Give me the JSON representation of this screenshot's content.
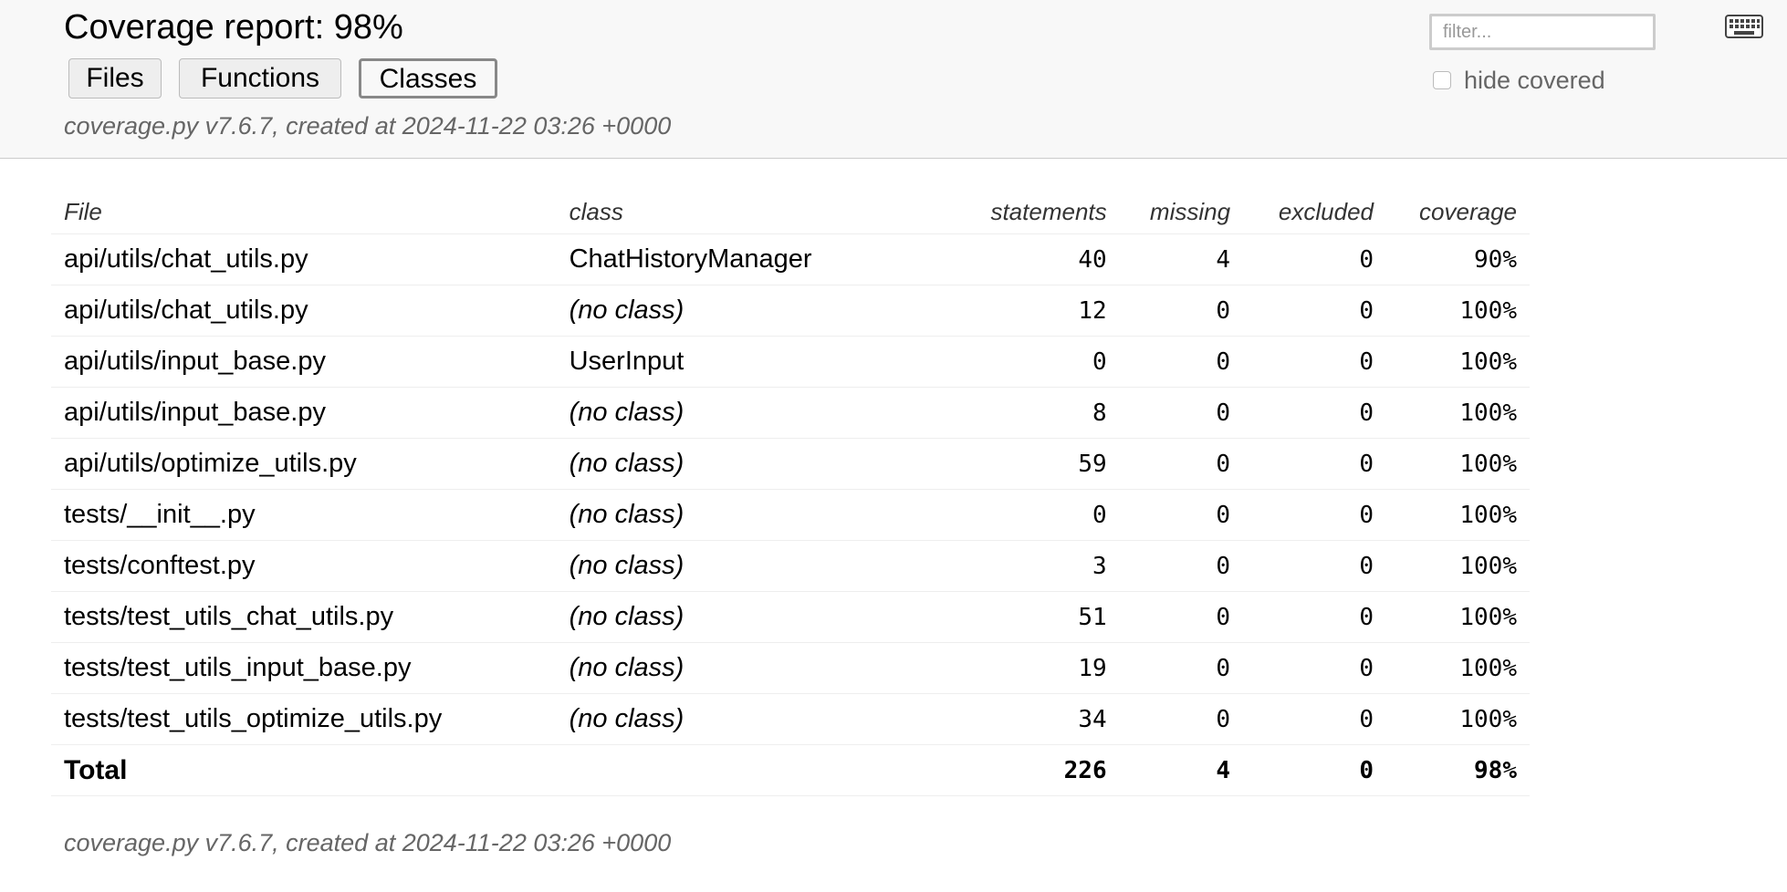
{
  "header": {
    "title": "Coverage report: 98%",
    "tabs": [
      {
        "label": "Files",
        "active": false
      },
      {
        "label": "Functions",
        "active": false
      },
      {
        "label": "Classes",
        "active": true
      }
    ],
    "meta": "coverage.py v7.6.7, created at 2024-11-22 03:26 +0000",
    "filter_placeholder": "filter...",
    "hide_covered_label": "hide covered",
    "hide_covered_checked": false,
    "keyboard_icon": "keyboard-icon"
  },
  "table": {
    "columns": {
      "file": "File",
      "class": "class",
      "statements": "statements",
      "missing": "missing",
      "excluded": "excluded",
      "coverage": "coverage"
    },
    "rows": [
      {
        "file": "api/utils/chat_utils.py",
        "class": "ChatHistoryManager",
        "statements": "40",
        "missing": "4",
        "excluded": "0",
        "coverage": "90%"
      },
      {
        "file": "api/utils/chat_utils.py",
        "class": "(no class)",
        "statements": "12",
        "missing": "0",
        "excluded": "0",
        "coverage": "100%"
      },
      {
        "file": "api/utils/input_base.py",
        "class": "UserInput",
        "statements": "0",
        "missing": "0",
        "excluded": "0",
        "coverage": "100%"
      },
      {
        "file": "api/utils/input_base.py",
        "class": "(no class)",
        "statements": "8",
        "missing": "0",
        "excluded": "0",
        "coverage": "100%"
      },
      {
        "file": "api/utils/optimize_utils.py",
        "class": "(no class)",
        "statements": "59",
        "missing": "0",
        "excluded": "0",
        "coverage": "100%"
      },
      {
        "file": "tests/__init__.py",
        "class": "(no class)",
        "statements": "0",
        "missing": "0",
        "excluded": "0",
        "coverage": "100%"
      },
      {
        "file": "tests/conftest.py",
        "class": "(no class)",
        "statements": "3",
        "missing": "0",
        "excluded": "0",
        "coverage": "100%"
      },
      {
        "file": "tests/test_utils_chat_utils.py",
        "class": "(no class)",
        "statements": "51",
        "missing": "0",
        "excluded": "0",
        "coverage": "100%"
      },
      {
        "file": "tests/test_utils_input_base.py",
        "class": "(no class)",
        "statements": "19",
        "missing": "0",
        "excluded": "0",
        "coverage": "100%"
      },
      {
        "file": "tests/test_utils_optimize_utils.py",
        "class": "(no class)",
        "statements": "34",
        "missing": "0",
        "excluded": "0",
        "coverage": "100%"
      }
    ],
    "total": {
      "label": "Total",
      "statements": "226",
      "missing": "4",
      "excluded": "0",
      "coverage": "98%"
    }
  },
  "footer": {
    "meta": "coverage.py v7.6.7, created at 2024-11-22 03:26 +0000"
  }
}
